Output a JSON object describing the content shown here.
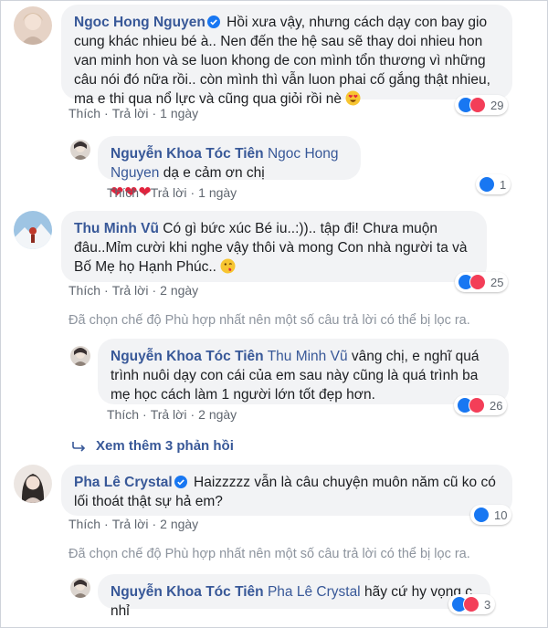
{
  "colors": {
    "link": "#385898",
    "like": "#1877f2",
    "love": "#f33e58",
    "bubble": "#f2f3f5",
    "meta": "#606770",
    "muted": "#8d949e"
  },
  "comments": [
    {
      "author": "Ngoc Hong Nguyen",
      "text": "Hồi xưa vậy, nhưng cách dạy con bay gio cung khác nhieu bé à.. Nen đến the hệ sau sẽ thay doi nhieu hon van minh hon và se luon khong de con mình tổn thương vì những câu nói đó nữa rồi.. còn mình thì vẫn luon phai cố gắng thật nhieu, ma e thi qua nổ lực và cũng qua giỏi rồi nè",
      "like": "Thích",
      "reply": "Trả lời",
      "time": "1 ngày",
      "reactions": "29",
      "reply_item": {
        "author": "Nguyễn Khoa Tóc Tiên",
        "tag": "Ngoc Hong Nguyen",
        "text": "dạ e cảm ơn chị",
        "like": "Thích",
        "reply": "Trả lời",
        "time": "1 ngày",
        "reactions": "1"
      }
    },
    {
      "author": "Thu Minh Vũ",
      "text": "Có gì bức xúc Bé iu..:)).. tập đi! Chưa muộn đâu..Mỉm cười khi nghe vậy thôi và mong Con nhà người ta và Bố Mẹ họ Hạnh Phúc..",
      "like": "Thích",
      "reply": "Trả lời",
      "time": "2 ngày",
      "reactions": "25",
      "filter_note": "Đã chọn chế độ Phù hợp nhất nên một số câu trả lời có thể bị lọc ra.",
      "reply_item": {
        "author": "Nguyễn Khoa Tóc Tiên",
        "tag": "Thu Minh Vũ",
        "text": "vâng chị, e nghĩ quá trình nuôi dạy con cái của em sau này cũng là quá trình ba mẹ học cách làm 1 người lớn tốt đẹp hơn.",
        "like": "Thích",
        "reply": "Trả lời",
        "time": "2 ngày",
        "reactions": "26"
      },
      "more_replies": "Xem thêm 3 phản hồi"
    },
    {
      "author": "Pha Lê Crystal",
      "text": "Haizzzzz vẫn là câu chuyện muôn năm cũ ko có lối thoát thật sự hả em?",
      "like": "Thích",
      "reply": "Trả lời",
      "time": "2 ngày",
      "reactions": "10",
      "filter_note": "Đã chọn chế độ Phù hợp nhất nên một số câu trả lời có thể bị lọc ra.",
      "reply_item": {
        "author": "Nguyễn Khoa Tóc Tiên",
        "tag": "Pha Lê Crystal",
        "text": "hãy cứ hy vọng c nhỉ",
        "reactions": "3"
      }
    }
  ]
}
